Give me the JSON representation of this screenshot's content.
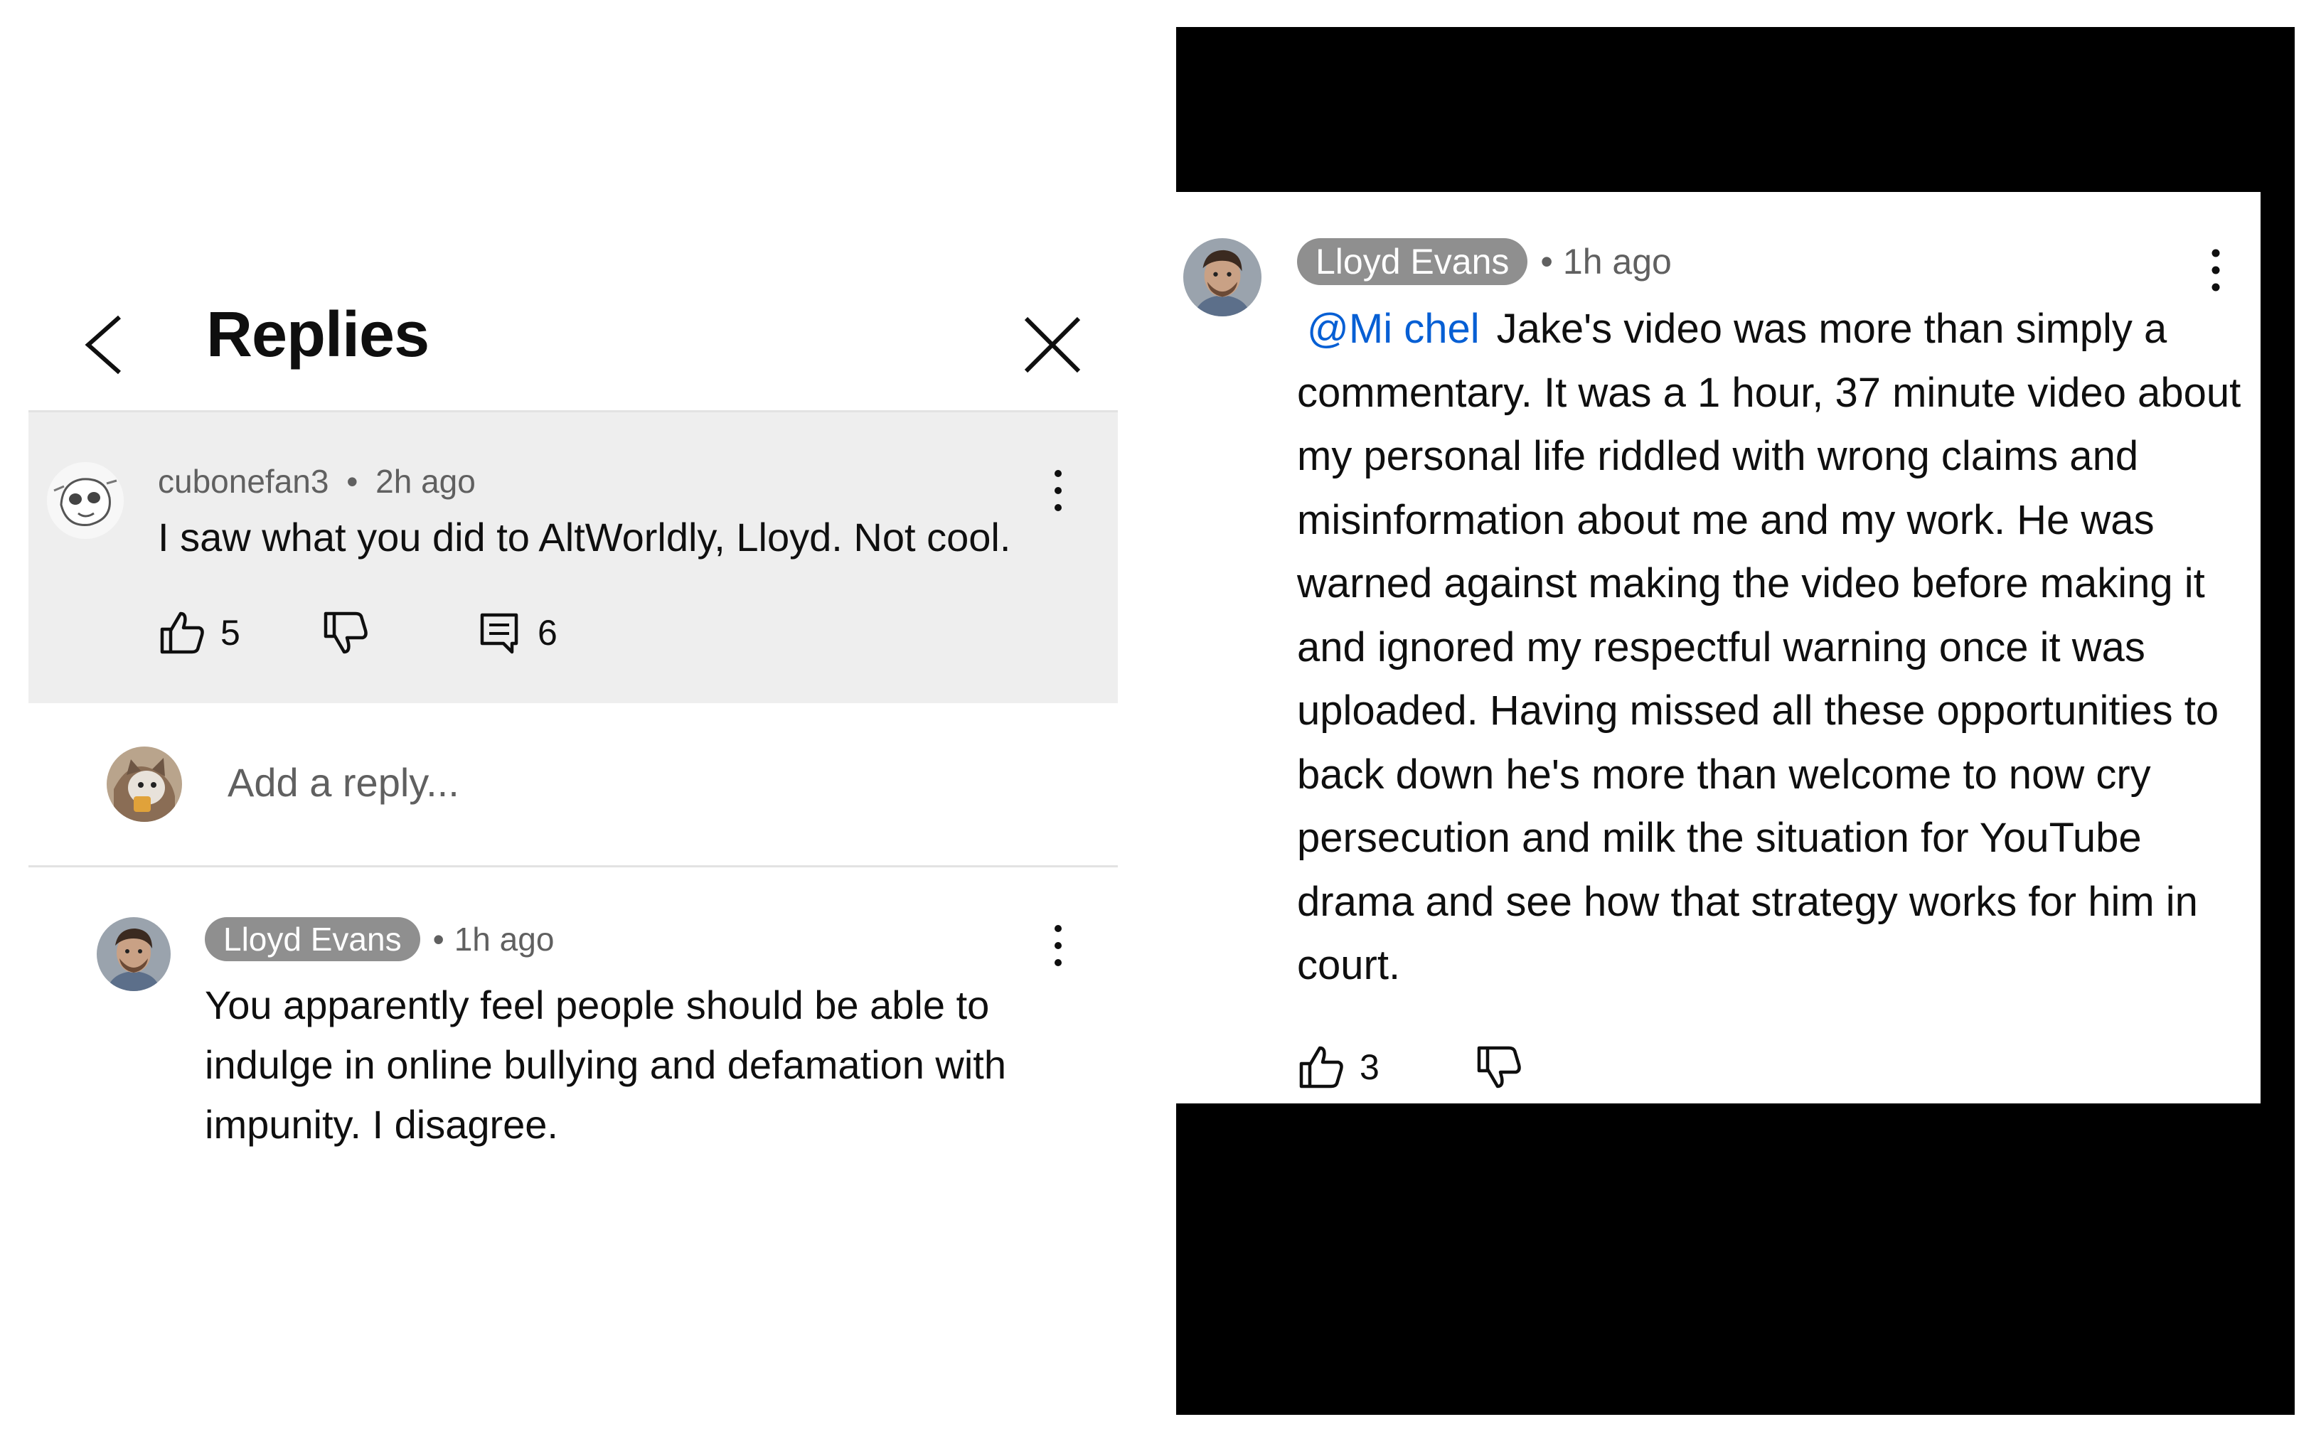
{
  "replies_panel": {
    "title": "Replies",
    "back_icon": "chevron-left-icon",
    "close_icon": "close-icon",
    "top_comment": {
      "author": "cubonefan3",
      "separator": "•",
      "time": "2h ago",
      "text": "I saw what you did to AltWorldly, Lloyd. Not cool.",
      "like_count": "5",
      "reply_count": "6"
    },
    "add_reply": {
      "placeholder": "Add a reply..."
    },
    "reply": {
      "author": "Lloyd Evans",
      "separator": "•",
      "time": "1h ago",
      "text": "You apparently feel people should be able to indulge in online bullying and defamation with impunity. I disagree."
    }
  },
  "zoomed_comment": {
    "author": "Lloyd Evans",
    "separator": "•",
    "time": "1h ago",
    "mention": "@Mi chel",
    "text": "Jake's video was more than simply a commentary. It was a 1 hour, 37 minute video about my personal life riddled with wrong claims and misinformation about me and my work. He was warned against making the video before making it and ignored my respectful warning once it was uploaded. Having missed all these opportunities to back down he's more than welcome to now cry persecution and milk the situation for YouTube drama and see how that strategy works for him in court.",
    "like_count": "3"
  },
  "colors": {
    "mention": "#065fd4",
    "author_pill": "#8f8f8f",
    "highlight_bg": "#eeeeee",
    "secondary_text": "#606060"
  }
}
